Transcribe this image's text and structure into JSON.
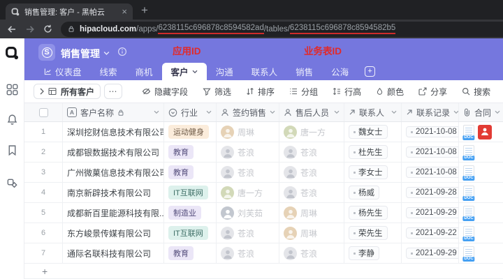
{
  "browser": {
    "tab_title": "销售管理: 客户 - 黑帕云",
    "url": {
      "domain": "hipacloud.com",
      "apps_segment": "/apps/",
      "app_id": "6238115c696878c8594582ad",
      "tables_segment": "/tables/",
      "table_id": "6238115c696878c8594582b5"
    }
  },
  "annotations": {
    "app_id_label": "应用ID",
    "table_id_label": "业务表ID",
    "annotation_color": "#e12a2a",
    "underline_color": "#cf2b2b"
  },
  "icons": {
    "close_tab": "×",
    "new_tab": "+",
    "more": "⋯",
    "add_tab": "+",
    "add_row": "+",
    "app_icon_letter": "S",
    "text_field_letter": "A"
  },
  "header": {
    "app_name": "销售管理",
    "accent_color": "#7577de",
    "tabs": [
      {
        "label": "仪表盘",
        "icon": "dashboard-icon",
        "active": false
      },
      {
        "label": "线索",
        "active": false
      },
      {
        "label": "商机",
        "active": false
      },
      {
        "label": "客户",
        "active": true,
        "has_caret": true
      },
      {
        "label": "沟通",
        "active": false
      },
      {
        "label": "联系人",
        "active": false
      },
      {
        "label": "销售",
        "active": false
      },
      {
        "label": "公海",
        "active": false
      }
    ]
  },
  "toolbar": {
    "view_name": "所有客户",
    "tools": [
      {
        "label": "隐藏字段",
        "icon": "eye-off-icon"
      },
      {
        "label": "筛选",
        "icon": "funnel-icon"
      },
      {
        "label": "排序",
        "icon": "sort-icon"
      },
      {
        "label": "分组",
        "icon": "group-icon"
      },
      {
        "label": "行高",
        "icon": "row-height-icon"
      },
      {
        "label": "颜色",
        "icon": "color-icon"
      },
      {
        "label": "分享",
        "icon": "share-icon"
      },
      {
        "label": "搜索",
        "icon": "search-icon"
      }
    ]
  },
  "table": {
    "doc_badge": "DOC",
    "columns": [
      {
        "label": "客户名称",
        "icon": "text-field-icon",
        "locked": true
      },
      {
        "label": "行业",
        "icon": "select-field-icon"
      },
      {
        "label": "签约销售",
        "icon": "person-icon"
      },
      {
        "label": "售后人员",
        "icon": "person-icon"
      },
      {
        "label": "联系人",
        "icon": "link-field-icon"
      },
      {
        "label": "联系记录",
        "icon": "link-field-icon"
      },
      {
        "label": "合同",
        "icon": "paperclip-icon"
      }
    ],
    "industry_colors": {
      "运动健身": "#fbecdb",
      "教育": "#ebe6f7",
      "IT互联网": "#ddf1ec",
      "制造业": "#ebe6f7"
    },
    "rows": [
      {
        "num": "1",
        "name": "深圳挖财信息技术有限公司",
        "industry": "运动健身",
        "sales": "周琳",
        "after_sales": "唐一方",
        "contact": "魏女士",
        "record": "2021-10-08",
        "attachments": [
          "doc",
          "photo"
        ]
      },
      {
        "num": "2",
        "name": "成都银数据技术有限公司",
        "industry": "教育",
        "sales": "苍浪",
        "after_sales": "苍浪",
        "contact": "杜先生",
        "record": "2021-10-08",
        "attachments": [
          "doc"
        ]
      },
      {
        "num": "3",
        "name": "广州微菓信息技术有限公司",
        "industry": "教育",
        "sales": "苍浪",
        "after_sales": "苍浪",
        "contact": "李女士",
        "record": "2021-10-08",
        "attachments": [
          "doc"
        ]
      },
      {
        "num": "4",
        "name": "南京新辟技术有限公司",
        "industry": "IT互联网",
        "sales": "唐一方",
        "after_sales": "苍浪",
        "contact": "杨威",
        "record": "2021-09-28",
        "attachments": [
          "doc"
        ]
      },
      {
        "num": "5",
        "name": "成都新百里能源科技有限...",
        "industry": "制造业",
        "sales": "刘芙茹",
        "after_sales": "周琳",
        "contact": "杨先生",
        "record": "2021-09-29",
        "attachments": [
          "doc"
        ]
      },
      {
        "num": "6",
        "name": "东方峻景传媒有限公司",
        "industry": "IT互联网",
        "sales": "苍浪",
        "after_sales": "周琳",
        "contact": "荣先生",
        "record": "2021-09-22",
        "attachments": [
          "doc"
        ]
      },
      {
        "num": "7",
        "name": "通际名联科技有限公司",
        "industry": "教育",
        "sales": "苍浪",
        "after_sales": "苍浪",
        "contact": "李静",
        "record": "2021-09-29",
        "attachments": [
          "doc"
        ]
      }
    ]
  }
}
